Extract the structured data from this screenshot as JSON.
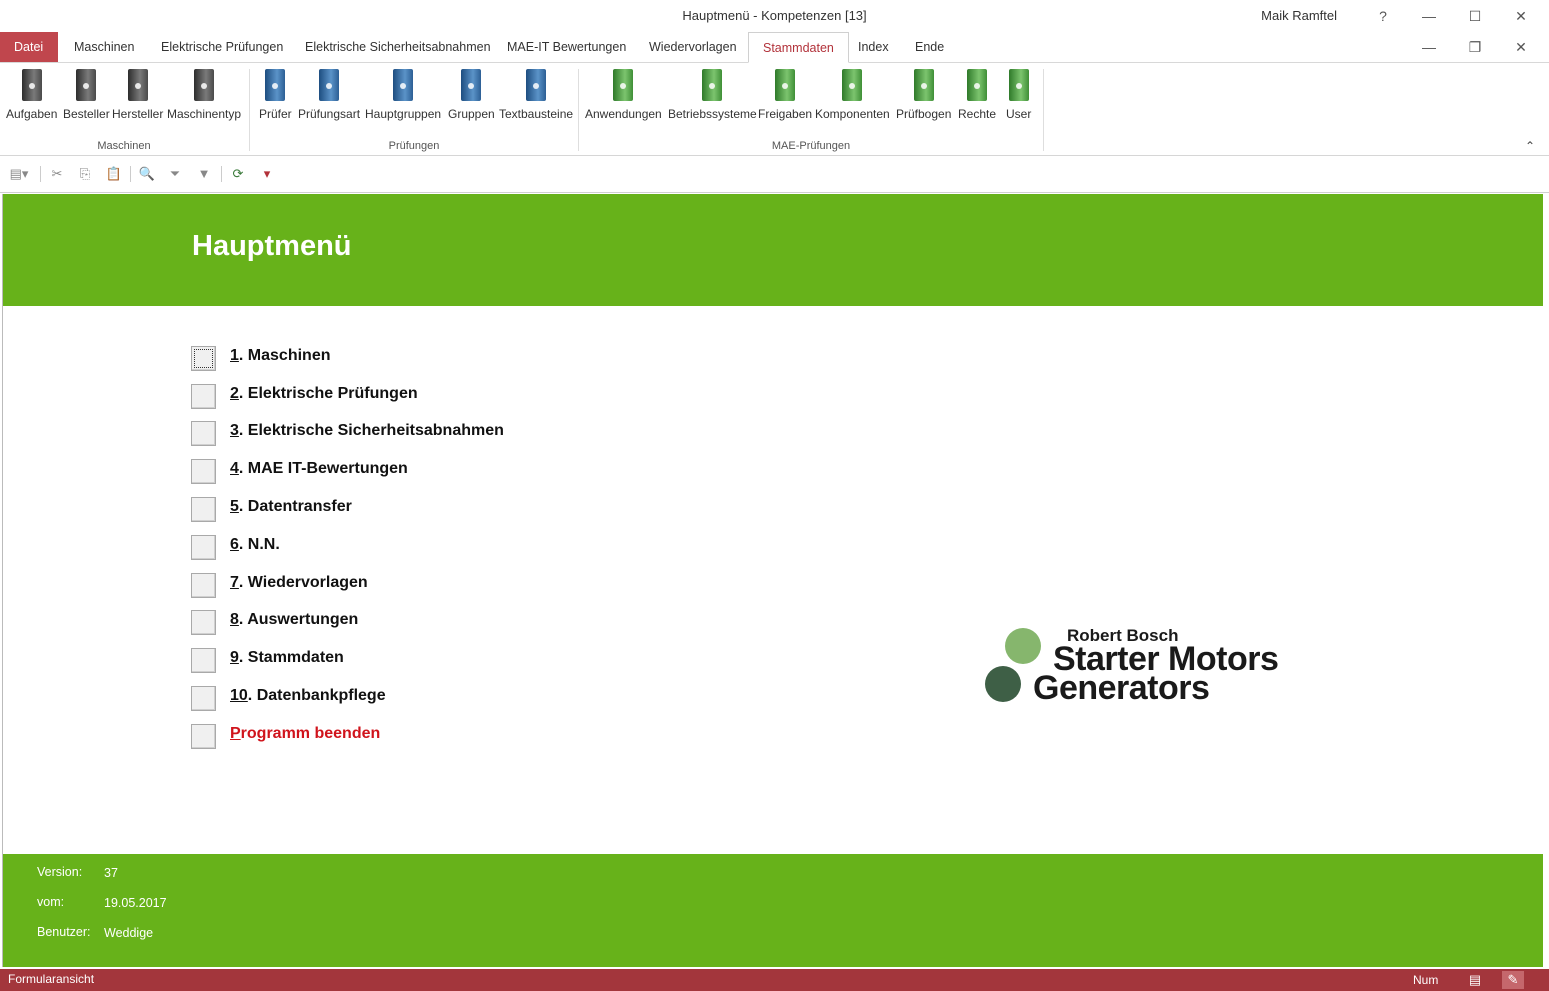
{
  "window": {
    "title": "Hauptmenü  -  Kompetenzen [13]",
    "user": "Maik Ramftel",
    "help_glyph": "?",
    "minimize_glyph": "—",
    "maximize_glyph": "☐",
    "close_glyph": "✕",
    "restore_glyph": "❐"
  },
  "tabs": [
    {
      "label": "Datei"
    },
    {
      "label": "Maschinen"
    },
    {
      "label": "Elektrische Prüfungen"
    },
    {
      "label": "Elektrische Sicherheitsabnahmen"
    },
    {
      "label": "MAE-IT Bewertungen"
    },
    {
      "label": "Wiedervorlagen"
    },
    {
      "label": "Stammdaten"
    },
    {
      "label": "Index"
    },
    {
      "label": "Ende"
    }
  ],
  "active_tab": "Stammdaten",
  "ribbon": {
    "groups": [
      {
        "label": "Maschinen",
        "color": "gray",
        "items": [
          "Aufgaben",
          "Besteller",
          "Hersteller",
          "Maschinentyp"
        ]
      },
      {
        "label": "Prüfungen",
        "color": "blue",
        "items": [
          "Prüfer",
          "Prüfungsart",
          "Hauptgruppen",
          "Gruppen",
          "Textbausteine"
        ]
      },
      {
        "label": "MAE-Prüfungen",
        "color": "green",
        "items": [
          "Anwendungen",
          "Betriebssysteme",
          "Freigaben",
          "Komponenten",
          "Prüfbogen",
          "Rechte",
          "User"
        ]
      }
    ],
    "collapse_glyph": "⌃"
  },
  "quick_access": {
    "icons": [
      "view-icon",
      "cut-icon",
      "copy-icon",
      "paste-icon",
      "search-icon",
      "filter-toggle-icon",
      "filter-icon",
      "refresh-icon",
      "customize-icon"
    ],
    "glyphs": [
      "▤▾",
      "✂",
      "⎘",
      "📋",
      "🔍",
      "⏷",
      "▼",
      "⟳",
      "▾"
    ]
  },
  "form": {
    "title": "Hauptmenü",
    "menu": [
      {
        "num": "1",
        "rest": ". Maschinen"
      },
      {
        "num": "2",
        "rest": ". Elektrische Prüfungen"
      },
      {
        "num": "3",
        "rest": ". Elektrische Sicherheitsabnahmen"
      },
      {
        "num": "4",
        "rest": ". MAE IT-Bewertungen"
      },
      {
        "num": "5",
        "rest": ". Datentransfer"
      },
      {
        "num": "6",
        "rest": ". N.N."
      },
      {
        "num": "7",
        "rest": ". Wiedervorlagen"
      },
      {
        "num": "8",
        "rest": ". Auswertungen"
      },
      {
        "num": "9",
        "rest": ". Stammdaten"
      },
      {
        "num": "10",
        "rest": ". Datenbankpflege"
      }
    ],
    "quit": {
      "num": "P",
      "rest": "rogramm beenden"
    },
    "footer": {
      "version_label": "Version:",
      "version_value": "37",
      "date_label": "vom:",
      "date_value": "19.05.2017",
      "user_label": "Benutzer:",
      "user_value": "Weddige"
    },
    "logo": {
      "line1": "Robert Bosch",
      "line2": "Starter Motors",
      "line3": "Generators"
    }
  },
  "status": {
    "left": "Formularansicht",
    "num": "Num",
    "form_view_glyph": "▤",
    "design_view_glyph": "✎"
  },
  "colors": {
    "accent_green": "#67b21a",
    "file_tab_red": "#c0464d",
    "status_red": "#a3363c",
    "quit_red": "#d0141c"
  }
}
